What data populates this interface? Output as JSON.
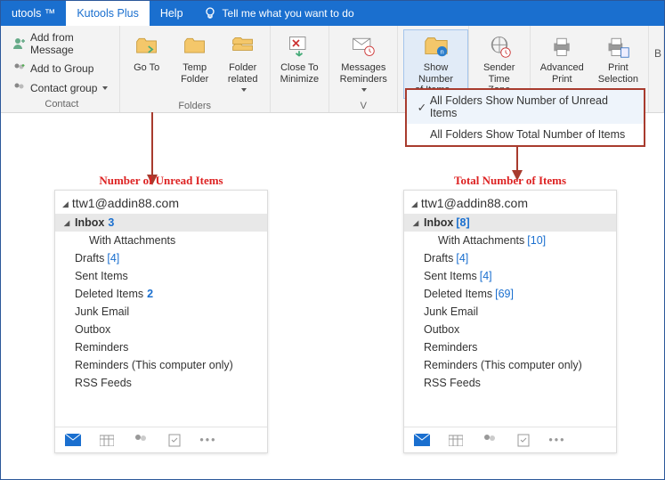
{
  "tabs": {
    "kutools": "utools ™",
    "plus": "Kutools Plus",
    "help": "Help",
    "tell": "Tell me what you want to do"
  },
  "ribbon": {
    "contact": {
      "add_from_message": "Add from Message",
      "add_to_group": "Add to Group",
      "contact_group": "Contact group",
      "label": "Contact"
    },
    "folders": {
      "go_to": "Go To",
      "temp_folder": "Temp\nFolder",
      "folder_related": "Folder\nrelated",
      "label": "Folders"
    },
    "close_to_minimize": "Close To\nMinimize",
    "messages_reminders": "Messages\nReminders",
    "show_number": "Show Number\nof Items",
    "sender_tz": "Sender\nTime Zone",
    "adv_print": "Advanced\nPrint",
    "print_sel": "Print\nSelection",
    "group_v": "V"
  },
  "dropdown": {
    "opt_unread": "All Folders Show Number of Unread Items",
    "opt_total": "All Folders Show Total Number of Items"
  },
  "panes": {
    "left": {
      "caption": "Number of Unread Items",
      "account": "ttw1@addin88.com",
      "items": [
        {
          "label": "Inbox",
          "count": "3",
          "style": "blue",
          "sel": true,
          "exp": true
        },
        {
          "label": "With Attachments",
          "count": "",
          "style": "",
          "indent": true
        },
        {
          "label": "Drafts",
          "count": "[4]",
          "style": "br"
        },
        {
          "label": "Sent Items",
          "count": "",
          "style": ""
        },
        {
          "label": "Deleted Items",
          "count": "2",
          "style": "blue"
        },
        {
          "label": "Junk Email",
          "count": "",
          "style": ""
        },
        {
          "label": "Outbox",
          "count": "",
          "style": ""
        },
        {
          "label": "Reminders",
          "count": "",
          "style": ""
        },
        {
          "label": "Reminders (This computer only)",
          "count": "",
          "style": ""
        },
        {
          "label": "RSS Feeds",
          "count": "",
          "style": ""
        }
      ]
    },
    "right": {
      "caption": "Total Number of Items",
      "account": "ttw1@addin88.com",
      "items": [
        {
          "label": "Inbox",
          "count": "[8]",
          "style": "br",
          "sel": true,
          "exp": true
        },
        {
          "label": "With Attachments",
          "count": "[10]",
          "style": "br",
          "indent": true
        },
        {
          "label": "Drafts",
          "count": "[4]",
          "style": "br"
        },
        {
          "label": "Sent Items",
          "count": "[4]",
          "style": "br"
        },
        {
          "label": "Deleted Items",
          "count": "[69]",
          "style": "br"
        },
        {
          "label": "Junk Email",
          "count": "",
          "style": ""
        },
        {
          "label": "Outbox",
          "count": "",
          "style": ""
        },
        {
          "label": "Reminders",
          "count": "",
          "style": ""
        },
        {
          "label": "Reminders (This computer only)",
          "count": "",
          "style": ""
        },
        {
          "label": "RSS Feeds",
          "count": "",
          "style": ""
        }
      ]
    }
  }
}
